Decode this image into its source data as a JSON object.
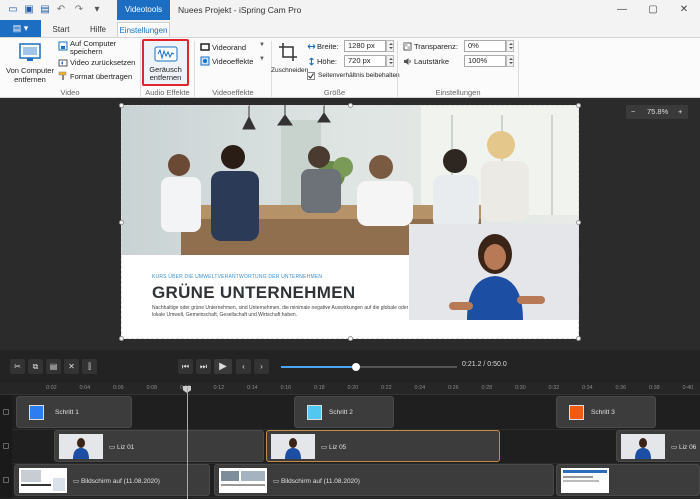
{
  "titlebar": {
    "context_tab": "Videotools",
    "title": "Nuees Projekt - iSpring Cam Pro",
    "quick_access": {
      "new": "▭",
      "open": "▣",
      "save": "▤",
      "undo": "↶",
      "redo": "↷",
      "more": "▾"
    },
    "window_controls": {
      "minimize": "—",
      "maximize": "▢",
      "close": "✕"
    }
  },
  "tabs": {
    "file": "▤ ▾",
    "start": "Start",
    "hilfe": "Hilfe",
    "einstellungen": "Einstellungen"
  },
  "ribbon": {
    "video": {
      "label": "Video",
      "from_computer": [
        "Von Computer",
        "entfernen"
      ],
      "save_to_computer": [
        "Auf Computer",
        "speichern"
      ],
      "reset_video": "Video zurücksetzen",
      "copy_format": "Format übertragen"
    },
    "audio": {
      "label": "Audio Effekte",
      "remove_noise": [
        "Geräusch",
        "entfernen"
      ]
    },
    "effects": {
      "label": "Videoeffekte",
      "video_edge": "Videorand",
      "video_effects": "Videoeffekte"
    },
    "size": {
      "label": "Größe",
      "crop": "Zuschneiden",
      "width_label": "Breite:",
      "width_value": "1280 px",
      "height_label": "Höhe:",
      "height_value": "720 px",
      "keep_ratio": "Seitenverhältnis beibehalten"
    },
    "settings": {
      "label": "Einstellungen",
      "transparency_label": "Transparenz:",
      "transparency_value": "0%",
      "volume_label": "Lautstärke",
      "volume_value": "100%"
    }
  },
  "canvas": {
    "zoom": "75.8%",
    "zoom_minus": "−",
    "zoom_plus": "+",
    "slide": {
      "subtitle": "KURS ÜBER DIE UMWELTVERANTWORTUNG DER UNTERNEHMEN",
      "title": "GRÜNE UNTERNEHMEN",
      "body": "Nachhaltige oder grüne Unternehmen, sind Unternehmen, die minimale negative Auswirkungen auf die globale oder lokale Umwelt, Gemeinschaft, Gesellschaft und Wirtschaft haben."
    }
  },
  "controls": {
    "cut": "✂",
    "copy": "⧉",
    "paste": "▤",
    "delete": "✕",
    "split": "⫿",
    "prev": "⏮",
    "next": "⏭",
    "play": "▶",
    "back": "‹",
    "forward": "›",
    "timecode": "0:21.2 / 0:50.0",
    "progress": 0.424
  },
  "timeline": {
    "ticks": [
      "0:02",
      "0:04",
      "0:06",
      "0:08",
      "0:10",
      "0:12",
      "0:14",
      "0:16",
      "0:18",
      "0:20",
      "0:22",
      "0:24",
      "0:26",
      "0:28",
      "0:30",
      "0:32",
      "0:34",
      "0:36",
      "0:38",
      "0:40"
    ],
    "steps": [
      {
        "label": "Schritt 1",
        "color": "#2d7cf0"
      },
      {
        "label": "Schritt 2",
        "color": "#52c8f0"
      },
      {
        "label": "Schritt 3",
        "color": "#f25a12"
      }
    ],
    "liz": [
      "Liz 01",
      "Liz 05",
      "Liz 06"
    ],
    "screens": [
      "Bildschirm auf (11.08.2020)",
      "Bildschirm auf (11.08.2020)"
    ]
  }
}
